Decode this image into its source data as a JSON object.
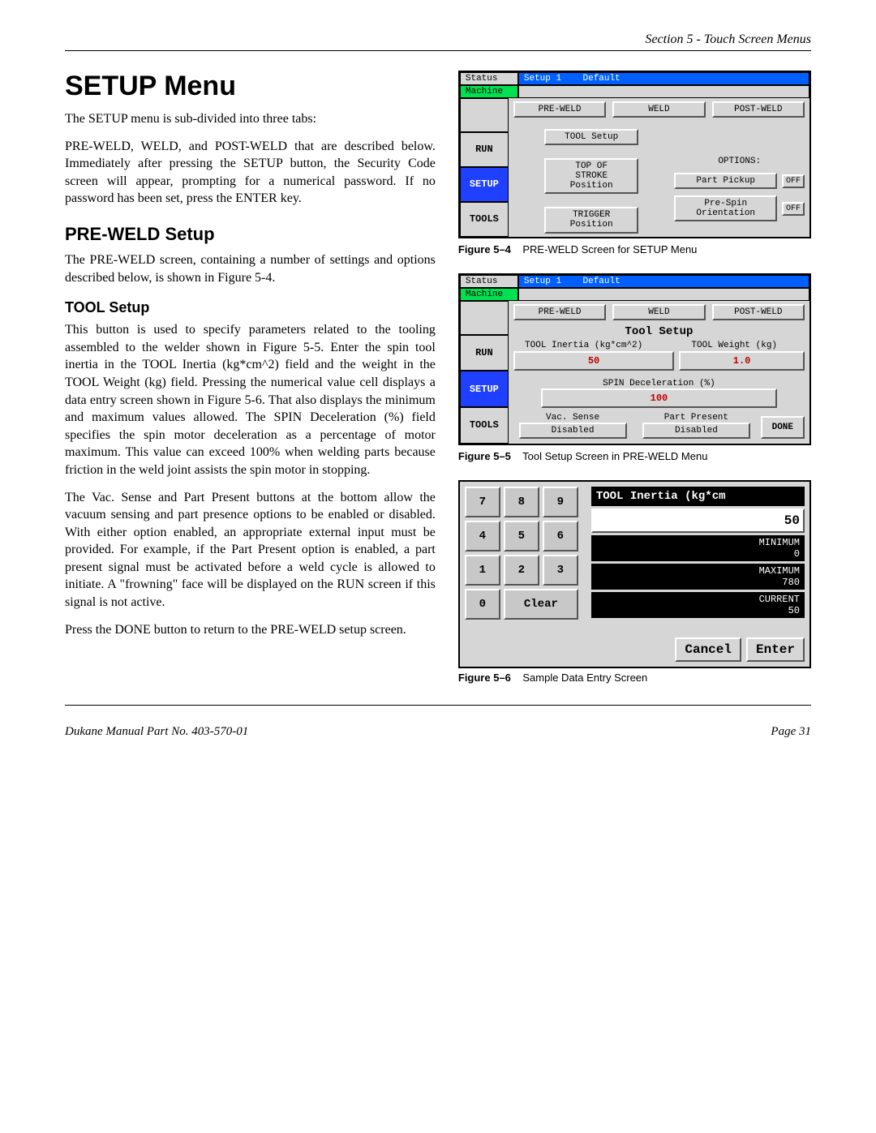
{
  "header": {
    "section": "Section 5 - Touch Screen Menus"
  },
  "h1": "SETUP Menu",
  "p1": "The SETUP menu is sub-divided into three tabs:",
  "p2": "PRE-WELD, WELD, and POST-WELD that are described below. Immediately after pressing the SETUP button, the Security Code screen will appear, prompting for a numerical password. If no password has been set, press the ENTER key.",
  "h2": "PRE-WELD Setup",
  "p3": "The PRE-WELD screen, containing a number of settings and options described below, is shown in Figure 5-4.",
  "h3": "TOOL Setup",
  "p4": "This button is used to specify parameters related to the tooling assembled to the welder shown in Figure 5-5. Enter the spin tool inertia in the TOOL Inertia (kg*cm^2) field and the weight in the TOOL Weight (kg) field. Pressing the numerical value cell displays a data entry screen shown in Figure 5-6. That also displays the minimum and maximum values allowed. The SPIN Deceleration (%) field specifies the spin motor deceleration as a percentage of motor maximum.  This value can exceed 100% when welding parts because friction in the weld joint assists the spin motor in stopping.",
  "p5": "The Vac. Sense and Part Present buttons at the bottom allow the vacuum sensing and part presence options to be enabled or disabled.  With either option enabled, an appropriate external input must be provided.  For example, if the Part Present option is enabled, a part present signal must be activated before a weld cycle is allowed to initiate.  A \"frowning\" face will be displayed on the RUN screen if this signal is not active.",
  "p6": "Press the DONE button to return to the PRE-WELD setup screen.",
  "fig54": {
    "status": "Status",
    "setup_label": "Setup 1",
    "default": "Default",
    "machine": "Machine",
    "tabs": [
      "PRE-WELD",
      "WELD",
      "POST-WELD"
    ],
    "side": {
      "run": "RUN",
      "setup": "SETUP",
      "tools": "TOOLS"
    },
    "tool_setup_btn": "TOOL Setup",
    "top_stroke": "TOP OF\nSTROKE\nPosition",
    "trigger": "TRIGGER\nPosition",
    "options_label": "OPTIONS:",
    "part_pickup": "Part Pickup",
    "pre_spin": "Pre-Spin\nOrientation",
    "off": "OFF",
    "caption_b": "Figure 5–4",
    "caption_t": "PRE-WELD Screen for SETUP Menu"
  },
  "fig55": {
    "status": "Status",
    "setup_label": "Setup 1",
    "default": "Default",
    "machine": "Machine",
    "tabs": [
      "PRE-WELD",
      "WELD",
      "POST-WELD"
    ],
    "side": {
      "run": "RUN",
      "setup": "SETUP",
      "tools": "TOOLS"
    },
    "title": "Tool Setup",
    "inertia_label": "TOOL Inertia (kg*cm^2)",
    "weight_label": "TOOL Weight (kg)",
    "inertia_val": "50",
    "weight_val": "1.0",
    "decel_label": "SPIN Deceleration (%)",
    "decel_val": "100",
    "vac_sense": "Vac. Sense",
    "part_present": "Part Present",
    "disabled": "Disabled",
    "done": "DONE",
    "caption_b": "Figure 5–5",
    "caption_t": "Tool Setup Screen in PRE-WELD Menu"
  },
  "fig56": {
    "keys": [
      "7",
      "8",
      "9",
      "4",
      "5",
      "6",
      "1",
      "2",
      "3",
      "0",
      "Clear"
    ],
    "title": "TOOL Inertia (kg*cm",
    "value": "50",
    "min_label": "MINIMUM",
    "min_val": "0",
    "max_label": "MAXIMUM",
    "max_val": "780",
    "cur_label": "CURRENT",
    "cur_val": "50",
    "cancel": "Cancel",
    "enter": "Enter",
    "caption_b": "Figure 5–6",
    "caption_t": "Sample Data Entry Screen"
  },
  "footer": {
    "left": "Dukane Manual Part No. 403-570-01",
    "right": "Page   31"
  }
}
